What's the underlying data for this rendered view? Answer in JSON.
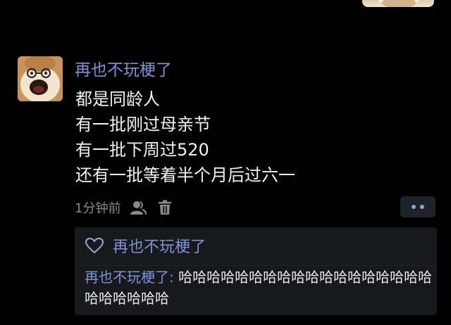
{
  "comment": {
    "username": "再也不玩梗了",
    "lines": [
      "都是同龄人",
      "有一批刚过母亲节",
      "有一批下周过520",
      "还有一批等着半个月后过六一"
    ],
    "time": "1分钟前"
  },
  "icons": {
    "user": "user-icon",
    "delete": "trash-icon",
    "more": "more-dots-icon",
    "like": "heart-outline-icon"
  },
  "likes": {
    "name": "再也不玩梗了"
  },
  "reply": {
    "author": "再也不玩梗了",
    "separator": ": ",
    "text": "哈哈哈哈哈哈哈哈哈哈哈哈哈哈哈哈哈哈哈哈哈哈哈哈"
  },
  "colors": {
    "background": "#000000",
    "username": "#7d93d6",
    "text": "#f2f2f2",
    "muted": "#8a8a8a",
    "panel": "#17191d"
  }
}
